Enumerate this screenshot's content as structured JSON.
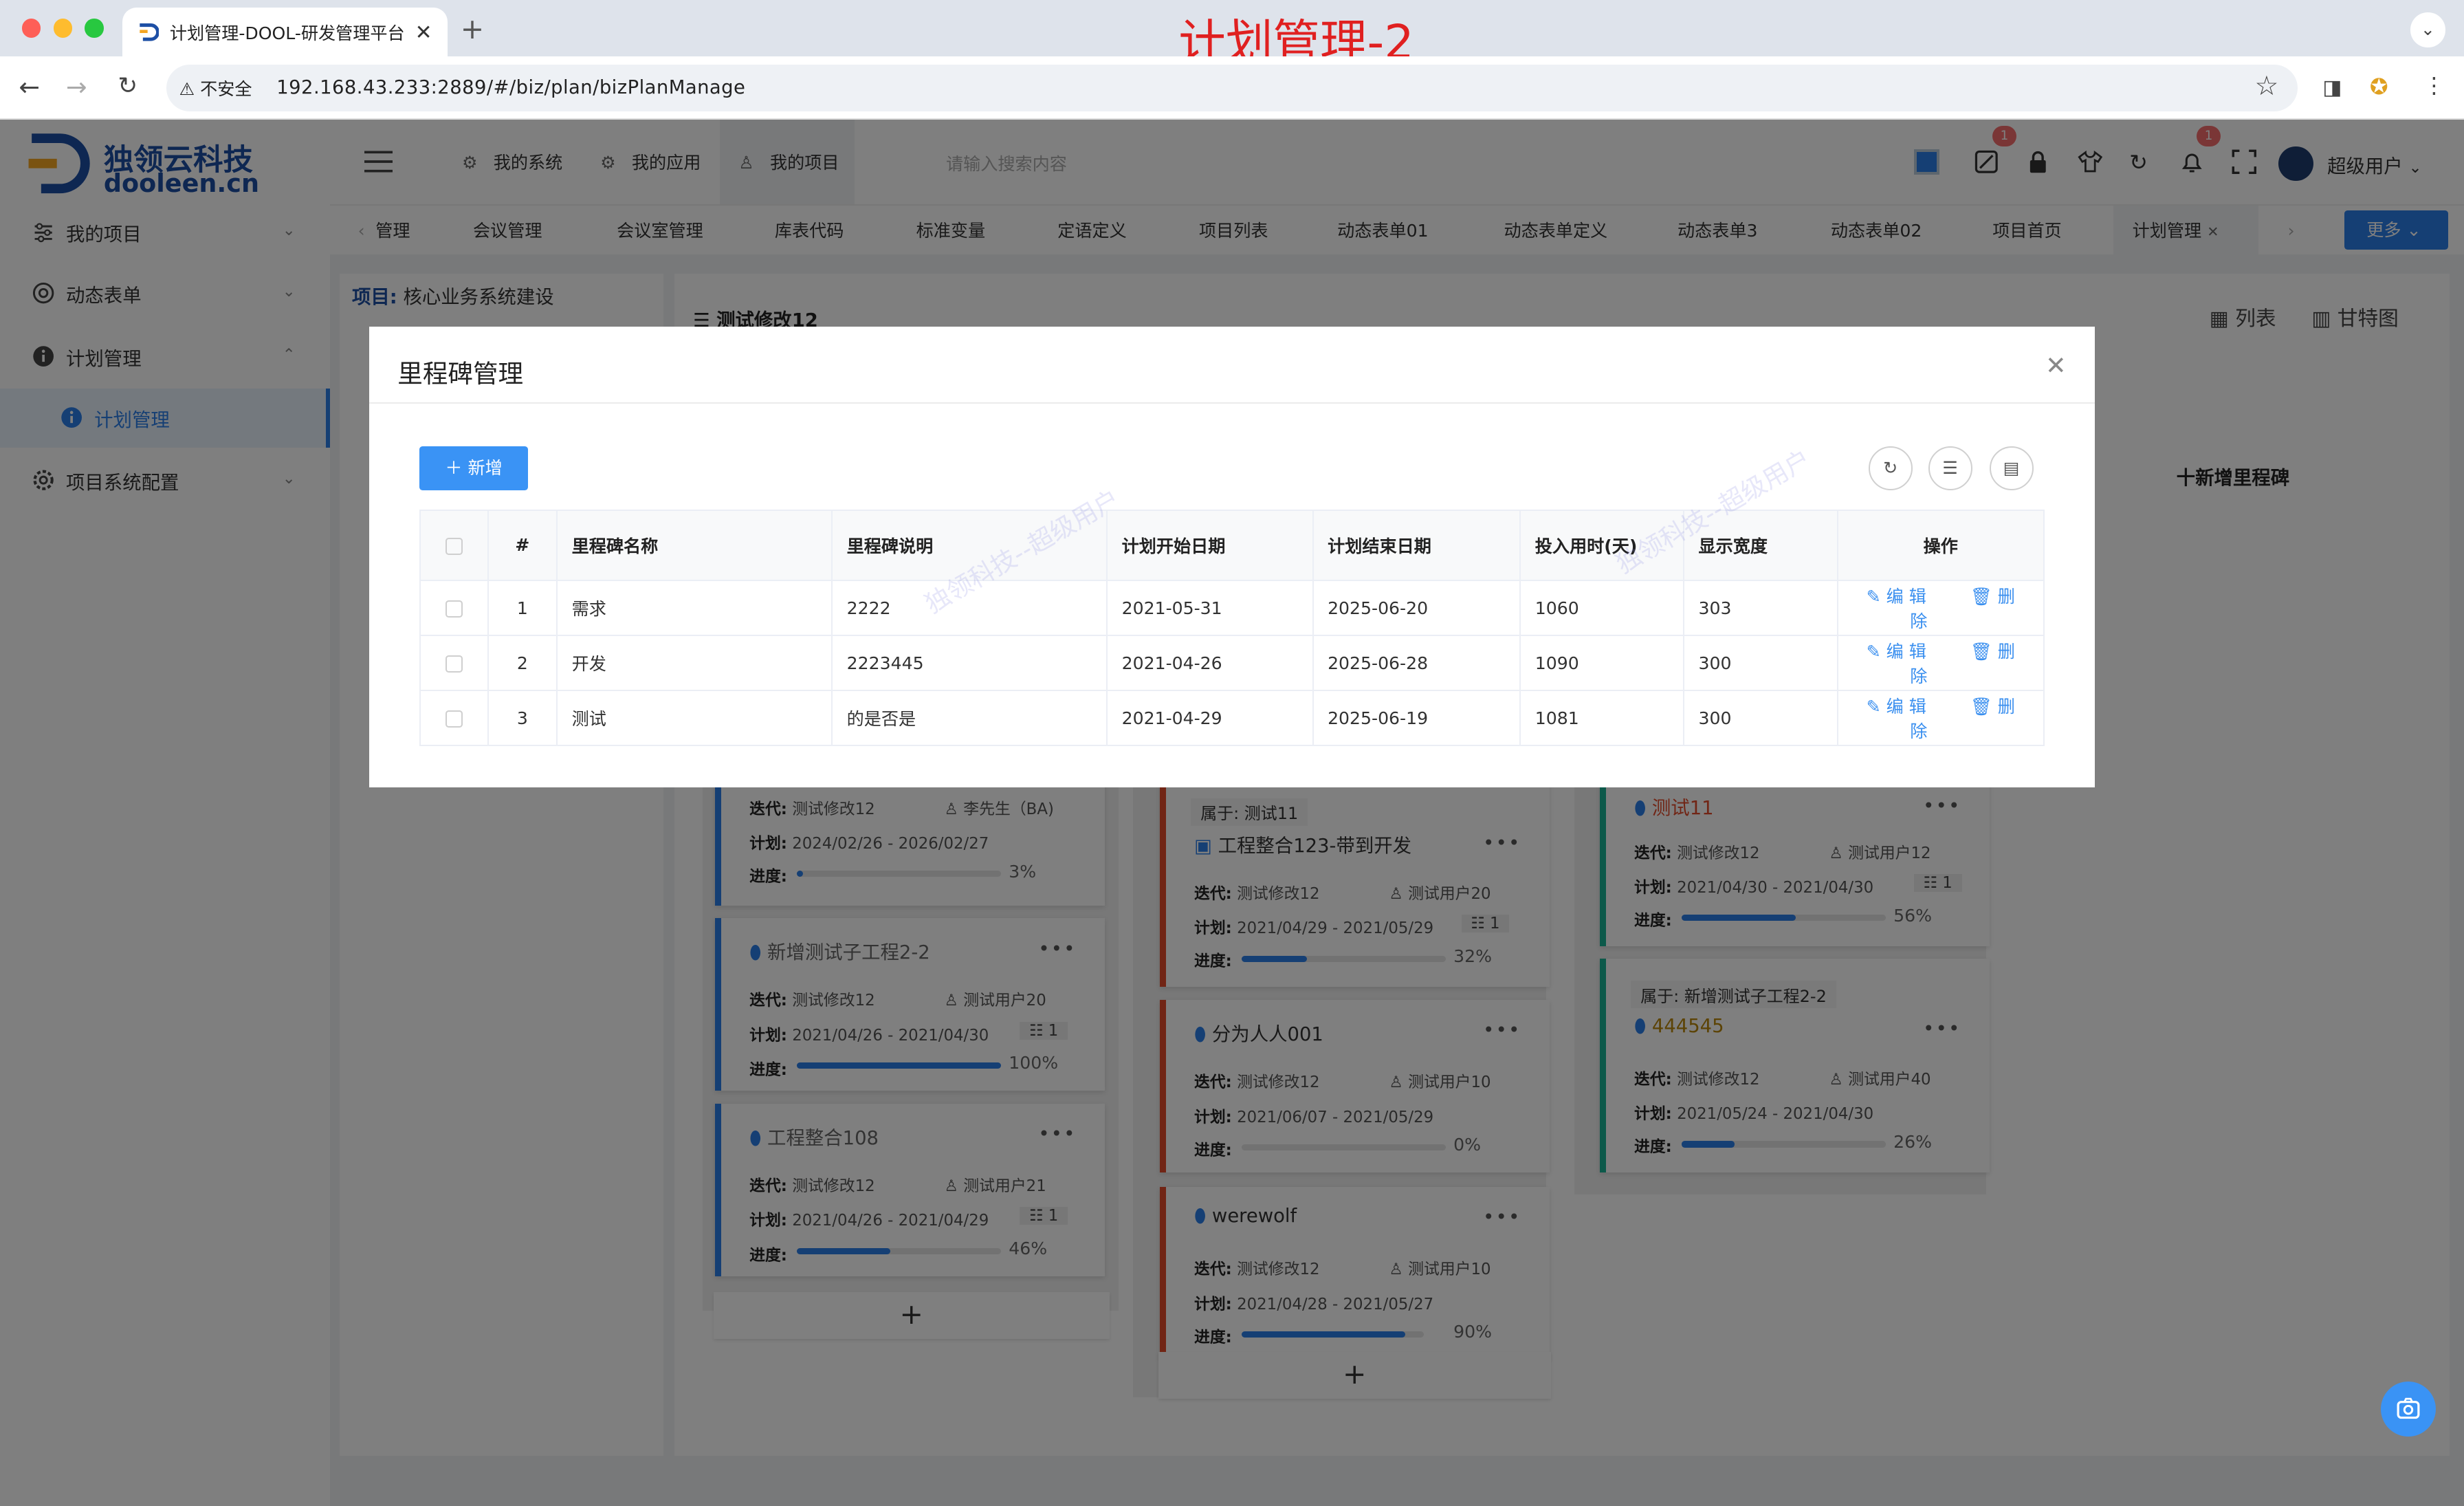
{
  "browser": {
    "tab_title": "计划管理-DOOL-研发管理平台",
    "insecure_label": "不安全",
    "url": "192.168.43.233:2889/#/biz/plan/bizPlanManage",
    "overlay_title": "计划管理-2"
  },
  "brand": {
    "name_cn": "独领云科技",
    "name_en": "dooleen.cn"
  },
  "sidebar": {
    "items": [
      {
        "label": "我的项目",
        "icon": "sliders-icon"
      },
      {
        "label": "动态表单",
        "icon": "form-icon"
      },
      {
        "label": "计划管理",
        "icon": "info-icon"
      },
      {
        "label": "计划管理",
        "icon": "info-icon"
      },
      {
        "label": "项目系统配置",
        "icon": "gear-icon"
      }
    ]
  },
  "topbar": {
    "nav": [
      "我的系统",
      "我的应用",
      "我的项目"
    ],
    "search_placeholder": "请输入搜索内容",
    "badges": [
      "1",
      "1"
    ],
    "user": "超级用户"
  },
  "page_tabs": [
    "管理",
    "会议管理",
    "会议室管理",
    "库表代码",
    "标准变量",
    "定语定义",
    "项目列表",
    "动态表单01",
    "动态表单定义",
    "动态表单3",
    "动态表单02",
    "项目首页",
    "计划管理"
  ],
  "more_label": "更多",
  "project": {
    "label": "项目:",
    "value": "核心业务系统建设"
  },
  "plan_title": "测试修改12",
  "view_list": "列表",
  "view_gantt": "甘特图",
  "add_milestone": "十新增里程碑",
  "kanban": {
    "col1": [
      {
        "title": "",
        "iter_label": "迭代:",
        "iter": "测试修改12",
        "owner": "李先生（BA)",
        "plan_label": "计划:",
        "plan": "2024/02/26 - 2026/02/27",
        "prog_label": "进度:",
        "progress": 3,
        "pct": "3%"
      },
      {
        "title": "新增测试子工程2-2",
        "iter_label": "迭代:",
        "iter": "测试修改12",
        "owner": "测试用户20",
        "plan_label": "计划:",
        "plan": "2021/04/26 - 2021/04/30",
        "count": "1",
        "prog_label": "进度:",
        "progress": 100,
        "pct": "100%"
      },
      {
        "title": "工程整合108",
        "iter_label": "迭代:",
        "iter": "测试修改12",
        "owner": "测试用户21",
        "plan_label": "计划:",
        "plan": "2021/04/26 - 2021/04/29",
        "count": "1",
        "prog_label": "进度:",
        "progress": 46,
        "pct": "46%"
      }
    ],
    "col2": [
      {
        "belong": "属于: 测试11",
        "title": "工程整合123-带到开发",
        "iter_label": "迭代:",
        "iter": "测试修改12",
        "owner": "测试用户20",
        "plan_label": "计划:",
        "plan": "2021/04/29 - 2021/05/29",
        "count": "1",
        "prog_label": "进度:",
        "progress": 32,
        "pct": "32%"
      },
      {
        "title": "分为人人001",
        "iter_label": "迭代:",
        "iter": "测试修改12",
        "owner": "测试用户10",
        "plan_label": "计划:",
        "plan": "2021/06/07 - 2021/05/29",
        "prog_label": "进度:",
        "progress": 0,
        "pct": "0%"
      },
      {
        "title": "werewolf",
        "iter_label": "迭代:",
        "iter": "测试修改12",
        "owner": "测试用户10",
        "plan_label": "计划:",
        "plan": "2021/04/28 - 2021/05/27",
        "prog_label": "进度:",
        "progress": 90,
        "pct": "90%"
      }
    ],
    "col3": [
      {
        "title": "测试11",
        "iter_label": "迭代:",
        "iter": "测试修改12",
        "owner": "测试用户12",
        "plan_label": "计划:",
        "plan": "2021/04/30 - 2021/04/30",
        "count": "1",
        "prog_label": "进度:",
        "progress": 56,
        "pct": "56%"
      },
      {
        "belong": "属于: 新增测试子工程2-2",
        "title": "444545",
        "iter_label": "迭代:",
        "iter": "测试修改12",
        "owner": "测试用户40",
        "plan_label": "计划:",
        "plan": "2021/05/24 - 2021/04/30",
        "prog_label": "进度:",
        "progress": 26,
        "pct": "26%"
      }
    ],
    "add_symbol": "+"
  },
  "modal": {
    "title": "里程碑管理",
    "add_label": "新增",
    "columns": [
      "#",
      "里程碑名称",
      "里程碑说明",
      "计划开始日期",
      "计划结束日期",
      "投入用时(天)",
      "显示宽度",
      "操作"
    ],
    "rows": [
      {
        "idx": "1",
        "name": "需求",
        "desc": "2222",
        "start": "2021-05-31",
        "end": "2025-06-20",
        "days": "1060",
        "width": "303"
      },
      {
        "idx": "2",
        "name": "开发",
        "desc": "2223445",
        "start": "2021-04-26",
        "end": "2025-06-28",
        "days": "1090",
        "width": "300"
      },
      {
        "idx": "3",
        "name": "测试",
        "desc": "的是否是",
        "start": "2021-04-29",
        "end": "2025-06-19",
        "days": "1081",
        "width": "300"
      }
    ],
    "edit_label": "编 辑",
    "delete_label": "删 除"
  },
  "watermark": "独领科技--超级用户",
  "colors": {
    "primary": "#2a7ee9",
    "danger": "#e34b2a",
    "teal": "#1ab394"
  }
}
